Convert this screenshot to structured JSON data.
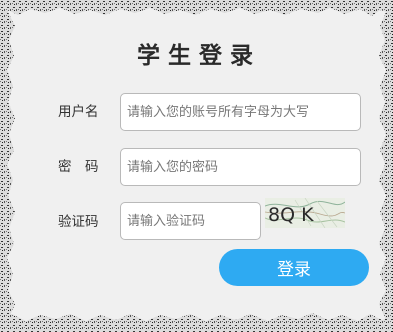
{
  "form": {
    "title": "学生登录",
    "username": {
      "label": "用户名",
      "placeholder": "请输入您的账号所有字母为大写",
      "value": ""
    },
    "password": {
      "label": "密　码",
      "placeholder": "请输入您的密码",
      "value": ""
    },
    "captcha": {
      "label": "验证码",
      "placeholder": "请输入验证码",
      "value": "",
      "image_text": "8Q K"
    },
    "login_label": "登录"
  },
  "colors": {
    "panel_background": "#f0f0f0",
    "button": "#2eaaf2",
    "button_text": "#ffffff"
  }
}
